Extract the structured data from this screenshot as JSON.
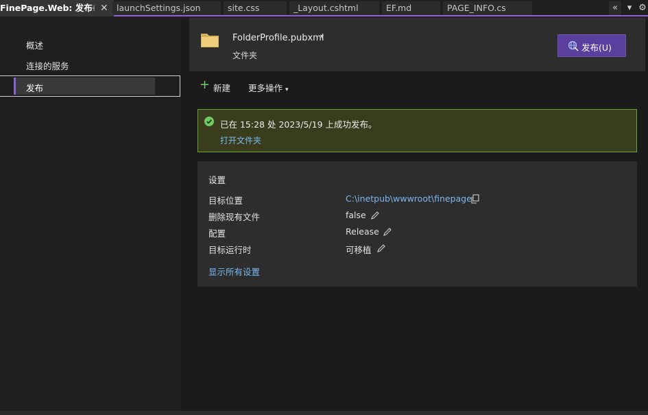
{
  "tabs": {
    "active": {
      "title": "FinePage.Web: 发布",
      "pin_icon": "pin-icon",
      "close_icon": "close-icon"
    },
    "others": [
      {
        "title": "launchSettings.json"
      },
      {
        "title": "site.css"
      },
      {
        "title": "_Layout.cshtml"
      },
      {
        "title": "EF.md"
      },
      {
        "title": "PAGE_INFO.cs"
      }
    ],
    "controls": {
      "scroll": "«",
      "menu": "▾",
      "gear": "⚙"
    }
  },
  "sidebar": {
    "items": [
      {
        "label": "概述"
      },
      {
        "label": "连接的服务"
      },
      {
        "label": "发布"
      }
    ],
    "selected": "发布"
  },
  "profile": {
    "name": "FolderProfile.pubxml",
    "caret": "▾",
    "subtitle": "文件夹",
    "icon": "folder-icon",
    "publish_button": "发布(U)"
  },
  "toolbar": {
    "new_icon": "+",
    "new_label": "新建",
    "more_label": "更多操作",
    "more_caret": "▾"
  },
  "notification": {
    "message": "已在 15:28 处 2023/5/19 上成功发布。",
    "link": "打开文件夹",
    "color": "#6aa43e"
  },
  "settings": {
    "title": "设置",
    "rows": [
      {
        "key": "目标位置",
        "value": "C:\\inetpub\\wwwroot\\finepage"
      },
      {
        "key": "删除现有文件",
        "value": "false"
      },
      {
        "key": "配置",
        "value": "Release"
      },
      {
        "key": "目标运行时",
        "value": "可移植"
      }
    ],
    "show_all": "显示所有设置"
  },
  "colors": {
    "accent": "#8a63d2",
    "publish_button": "#5b3f9e",
    "link": "#79b8f0",
    "success_border": "#6aa43e"
  }
}
